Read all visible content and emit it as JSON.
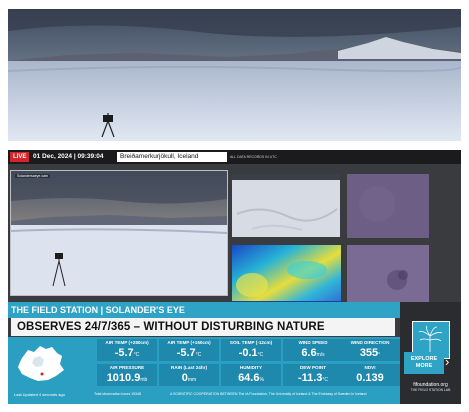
{
  "topbar": {
    "live_label": "LIVE",
    "datetime": "01 Dec, 2024 | 09:39:04",
    "location": "Breiðamerkurjökull, Iceland",
    "records_note": "ALL DATA RECORDS IN UTC"
  },
  "cameras": {
    "main_label": "Solandersaeye.cam"
  },
  "banner": {
    "station": "THE FIELD STATION | SOLANDER'S EYE",
    "tagline": "OBSERVES 24/7/365 – WITHOUT DISTURBING NATURE"
  },
  "sensors": [
    {
      "label": "AIR TEMP (+280cm)",
      "value": "-5.7",
      "unit": "°C"
    },
    {
      "label": "AIR TEMP (+160cm)",
      "value": "-5.7",
      "unit": "°C"
    },
    {
      "label": "SOIL TEMP (-12cm)",
      "value": "-0.1",
      "unit": "°C"
    },
    {
      "label": "WIND SPEED",
      "value": "6.6",
      "unit": "m/s"
    },
    {
      "label": "WIND DIRECTION",
      "value": "355",
      "unit": "°"
    },
    {
      "label": "AIR PRESSURE",
      "value": "1010.9",
      "unit": "mb"
    },
    {
      "label": "RAIN (Last 24hr)",
      "value": "0",
      "unit": "mm"
    },
    {
      "label": "HUMIDITY",
      "value": "64.6",
      "unit": "%"
    },
    {
      "label": "DEW POINT",
      "value": "-11.3",
      "unit": "°C"
    },
    {
      "label": "NDVI",
      "value": "0.139",
      "unit": ""
    }
  ],
  "footer": {
    "updated": "Last Updated 4 seconds ago",
    "hours": "Total observation hours 19348",
    "coop": "A SCIENTIFIC COOPERATION BETWEEN The IA Foundation, The University of Iceland & The Embassy of Sweden in Iceland"
  },
  "side": {
    "explore_line1": "EXPLORE",
    "explore_line2": "MORE",
    "arrow": "›",
    "site": "fifoundation.org",
    "site_sub": "THE FIELD STATION LAB"
  },
  "colors": {
    "accent": "#2ea3c6",
    "live": "#d3262b",
    "tile": "#1e88ad"
  }
}
